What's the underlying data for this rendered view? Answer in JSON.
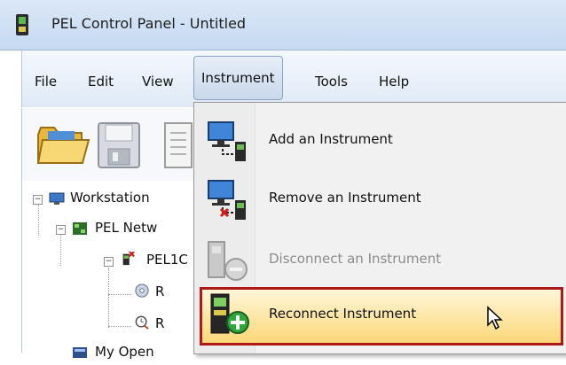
{
  "window": {
    "title": "PEL Control Panel - Untitled"
  },
  "menubar": {
    "items": [
      "File",
      "Edit",
      "View",
      "Instrument",
      "Tools",
      "Help"
    ],
    "active": "Instrument"
  },
  "toolbar": {
    "icons": [
      "open-folder-icon",
      "save-icon",
      "document-icon"
    ]
  },
  "tree": {
    "workstation": "Workstation",
    "pel_network": "PEL Netw",
    "pel_device": "PEL1C",
    "child_1": "R",
    "child_2": "R",
    "my_open": "My Open"
  },
  "instrument_menu": {
    "items": [
      {
        "label": "Add an Instrument",
        "icon": "add-instrument-icon",
        "enabled": true,
        "highlighted": false
      },
      {
        "label": "Remove an Instrument",
        "icon": "remove-instrument-icon",
        "enabled": true,
        "highlighted": false
      },
      {
        "label": "Disconnect an Instrument",
        "icon": "disconnect-instrument-icon",
        "enabled": false,
        "highlighted": false
      },
      {
        "label": "Reconnect Instrument",
        "icon": "reconnect-instrument-icon",
        "enabled": true,
        "highlighted": true
      }
    ]
  },
  "colors": {
    "highlight_border": "#b01818",
    "highlight_fill": "#fbd878",
    "menu_bg": "#f1f1f1"
  }
}
